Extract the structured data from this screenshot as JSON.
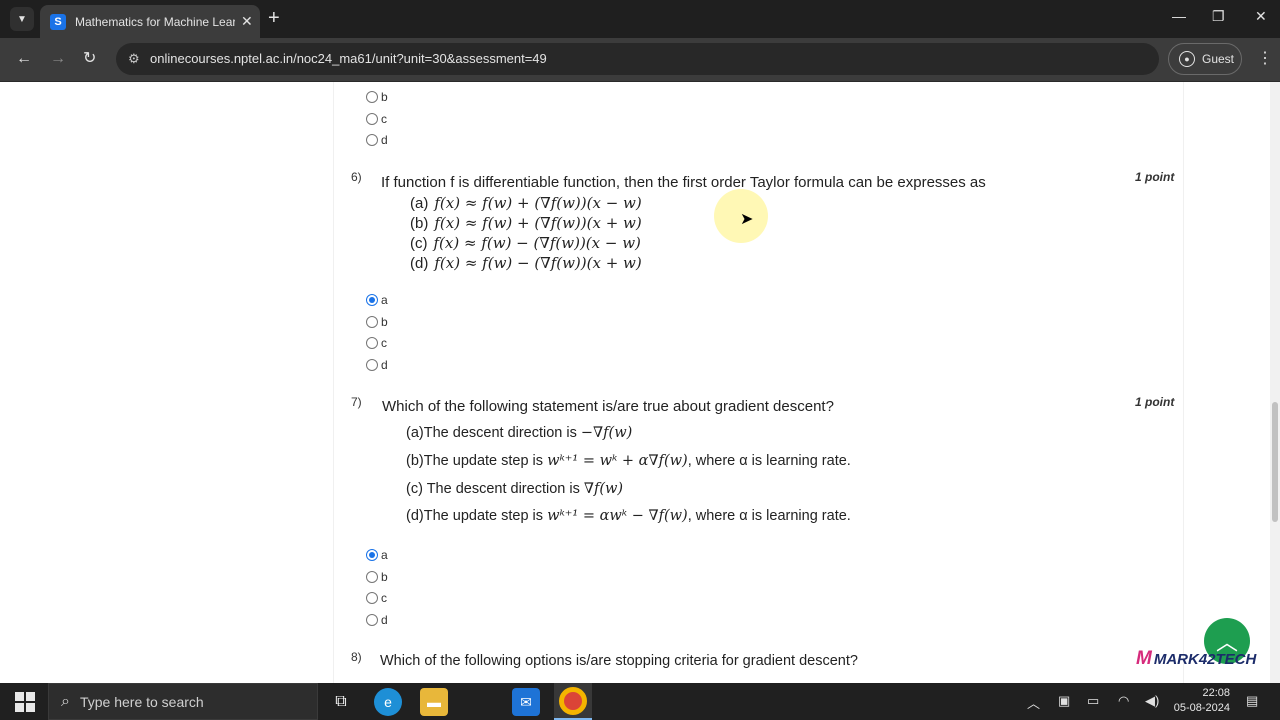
{
  "browser": {
    "tab_title": "Mathematics for Machine Learn",
    "tab_favicon": "S",
    "url": "onlinecourses.nptel.ac.in/noc24_ma61/unit?unit=30&assessment=49",
    "profile_label": "Guest"
  },
  "prev_question": {
    "options": [
      "b",
      "c",
      "d"
    ]
  },
  "q6": {
    "number": "6)",
    "points": "1 point",
    "text": "If function f is differentiable function, then the first order Taylor formula can be expresses as",
    "choices": [
      {
        "label": "(a)",
        "expr": "f(x) ≈ f(w) + (∇f(w))(x − w)"
      },
      {
        "label": "(b)",
        "expr": "f(x) ≈ f(w) + (∇f(w))(x + w)"
      },
      {
        "label": "(c)",
        "expr": "f(x) ≈ f(w) − (∇f(w))(x − w)"
      },
      {
        "label": "(d)",
        "expr": "f(x) ≈ f(w) − (∇f(w))(x + w)"
      }
    ],
    "options": [
      "a",
      "b",
      "c",
      "d"
    ],
    "selected": "a"
  },
  "q7": {
    "number": "7)",
    "points": "1 point",
    "text": "Which of the following statement is/are true about gradient descent?",
    "choices": [
      {
        "label": "(a)",
        "text": "The descent direction is ",
        "math": "−∇f(w)",
        "suffix": ""
      },
      {
        "label": "(b)",
        "text": "The update step is ",
        "math": "wᵏ⁺¹ = wᵏ + α∇f(w)",
        "suffix": ", where α is learning rate."
      },
      {
        "label": "(c)",
        "text": " The descent direction is ",
        "math": "∇f(w)",
        "suffix": ""
      },
      {
        "label": "(d)",
        "text": "The update step is ",
        "math": "wᵏ⁺¹ = αwᵏ − ∇f(w)",
        "suffix": ", where α is learning rate."
      }
    ],
    "options": [
      "a",
      "b",
      "c",
      "d"
    ],
    "selected": "a"
  },
  "q8": {
    "number": "8)",
    "text": "Which of the following options is/are stopping criteria for gradient descent?"
  },
  "watermark": {
    "logo": "M",
    "text": "MARK42TECH"
  },
  "taskbar": {
    "search_placeholder": "Type here to search",
    "time": "22:08",
    "date": "05-08-2024"
  },
  "icons": [
    "chevron-down-icon",
    "close-icon",
    "plus-icon",
    "back-arrow-icon",
    "forward-arrow-icon",
    "reload-icon",
    "site-info-icon",
    "person-icon",
    "more-vert-icon",
    "mouse-cursor-icon",
    "chevron-up-icon",
    "windows-start-icon",
    "search-icon"
  ]
}
